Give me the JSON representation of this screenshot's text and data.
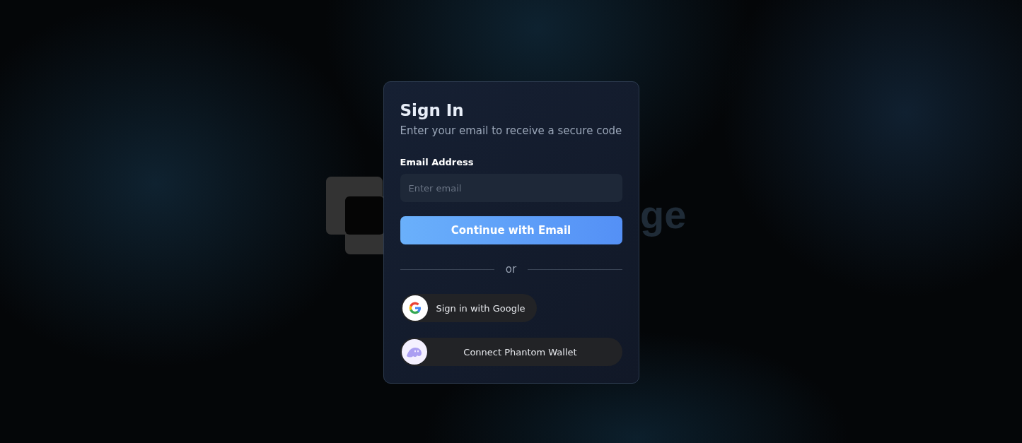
{
  "background_logo": {
    "text": "ge"
  },
  "card": {
    "title": "Sign In",
    "subtitle": "Enter your email to receive a secure code",
    "email": {
      "label": "Email Address",
      "placeholder": "Enter email"
    },
    "primary_button": "Continue with Email",
    "divider": "or",
    "providers": [
      {
        "kind": "google",
        "label": "Sign in with Google"
      },
      {
        "kind": "phantom",
        "label": "Connect Phantom Wallet"
      }
    ]
  }
}
